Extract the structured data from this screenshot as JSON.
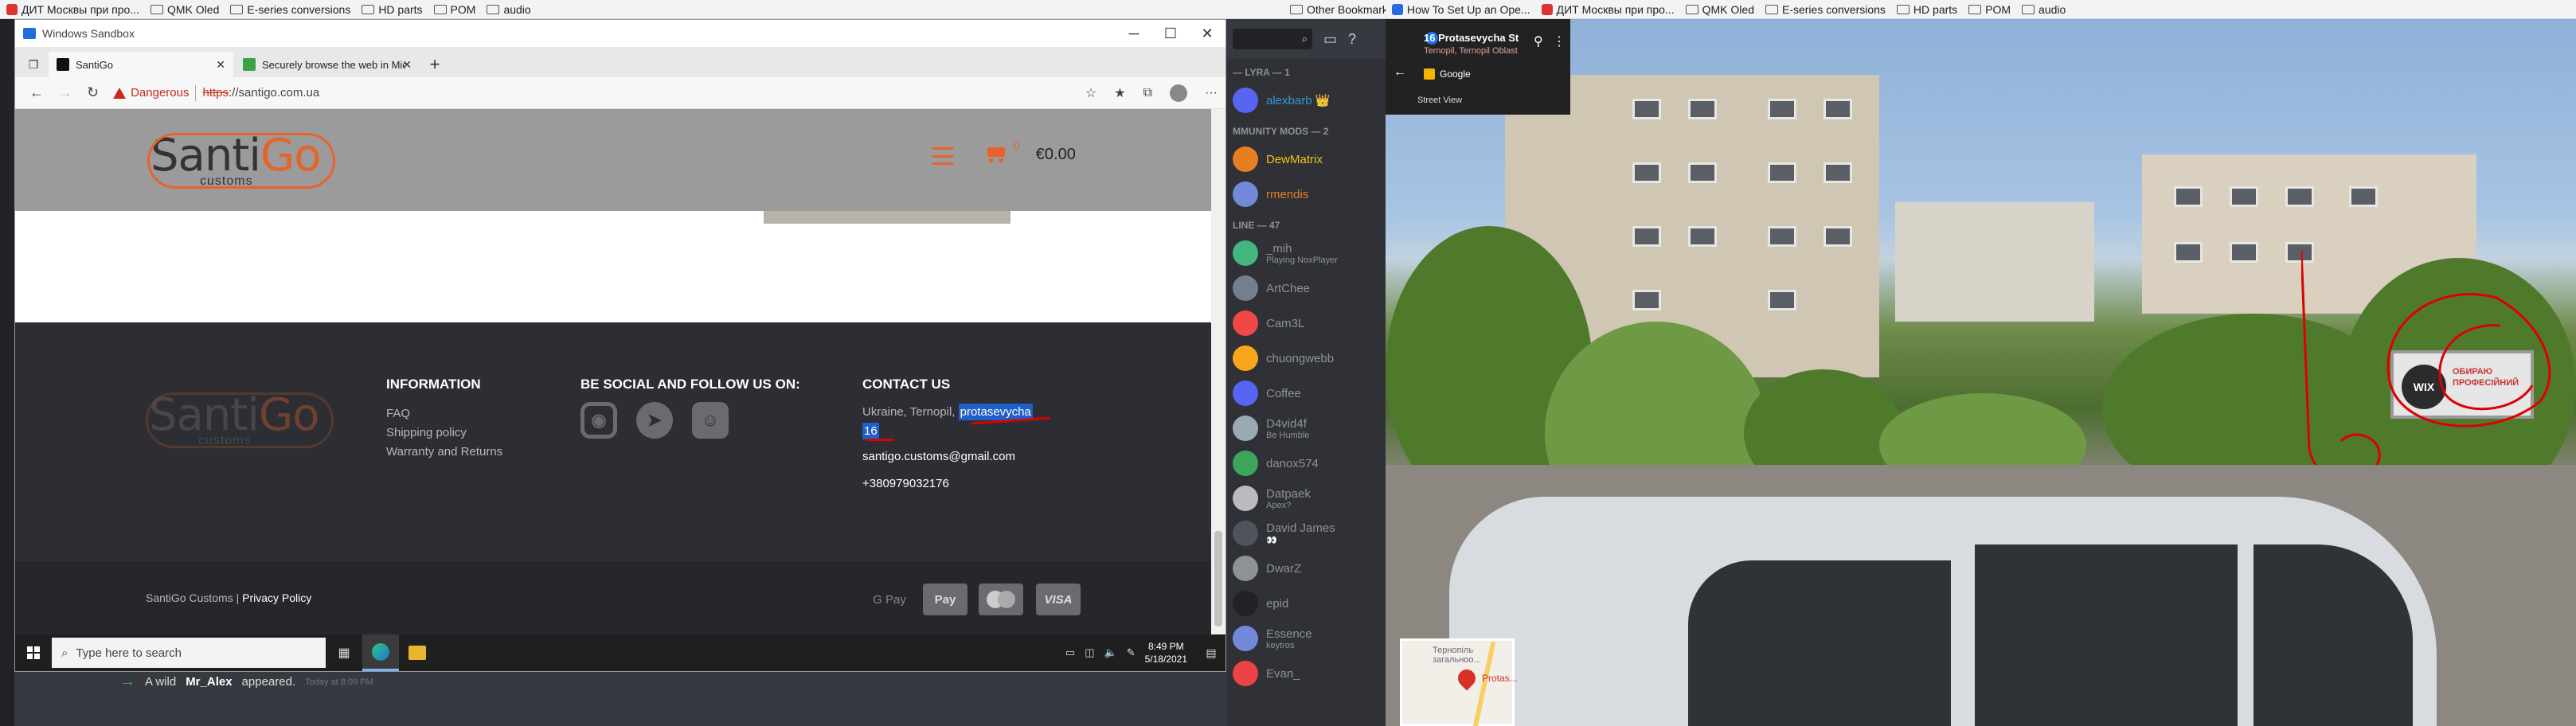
{
  "bookmarks_left": [
    {
      "icon": "red-flag-favicon",
      "label": "ДИТ Москвы при про..."
    },
    {
      "icon": "folder-icon",
      "label": "QMK Oled"
    },
    {
      "icon": "folder-icon",
      "label": "E-series conversions"
    },
    {
      "icon": "folder-icon",
      "label": "HD parts"
    },
    {
      "icon": "folder-icon",
      "label": "POM"
    },
    {
      "icon": "folder-icon",
      "label": "audio"
    }
  ],
  "bookmarks_left_other": "Other Bookmarks",
  "bookmarks_right": [
    {
      "icon": "github-favicon",
      "label": "How To Set Up an Ope..."
    },
    {
      "icon": "red-flag-favicon",
      "label": "ДИТ Москвы при про..."
    },
    {
      "icon": "folder-icon",
      "label": "QMK Oled"
    },
    {
      "icon": "folder-icon",
      "label": "E-series conversions"
    },
    {
      "icon": "folder-icon",
      "label": "HD parts"
    },
    {
      "icon": "folder-icon",
      "label": "POM"
    },
    {
      "icon": "folder-icon",
      "label": "audio"
    }
  ],
  "sandbox": {
    "title": "Windows Sandbox",
    "tabs": [
      {
        "label": "SantiGo",
        "active": true
      },
      {
        "label": "Securely browse the web in Micr",
        "active": false
      }
    ],
    "address": {
      "warning": "Dangerous",
      "scheme": "https",
      "rest": "://santigo.com.ua"
    }
  },
  "site": {
    "logo_main": "Santi",
    "logo_go": "Go",
    "logo_sub": "customs",
    "cart_count": "0",
    "cart_total": "€0.00",
    "footer": {
      "info_title": "INFORMATION",
      "info_links": [
        "FAQ",
        "Shipping policy",
        "Warranty and Returns"
      ],
      "social_title": "BE SOCIAL AND FOLLOW US ON:",
      "contact_title": "CONTACT US",
      "address_prefix": "Ukraine, Ternopil,",
      "address_street": "protasevycha",
      "address_number": "16",
      "email": "santigo.customs@gmail.com",
      "phone": "+380979032176"
    },
    "copyright": "SantiGo Customs",
    "copyright_sep": "|",
    "privacy": "Privacy Policy",
    "payments": [
      "G Pay",
      "Apple Pay",
      "Mastercard",
      "VISA"
    ],
    "payment_gpay": "G Pay",
    "payment_apay": " Pay",
    "payment_visa": "VISA"
  },
  "taskbar": {
    "search_placeholder": "Type here to search",
    "time": "8:49 PM",
    "date": "5/18/2021"
  },
  "discord": {
    "sections": [
      {
        "title": "— LYRA — 1",
        "members": [
          {
            "name": "alexbarb 👑",
            "role": "blue",
            "sub": ""
          }
        ]
      },
      {
        "title": "MMUNITY MODS — 2",
        "members": [
          {
            "name": "DewMatrix",
            "role": "gold",
            "sub": ""
          },
          {
            "name": "rmendis",
            "role": "orange",
            "sub": ""
          }
        ]
      },
      {
        "title": "LINE — 47",
        "members": [
          {
            "name": "_mih",
            "role": "",
            "sub": "Playing NoxPlayer"
          },
          {
            "name": "ArtChee",
            "role": "",
            "sub": ""
          },
          {
            "name": "Cam3L",
            "role": "",
            "sub": ""
          },
          {
            "name": "chuongwebb",
            "role": "",
            "sub": ""
          },
          {
            "name": "Coffee",
            "role": "",
            "sub": ""
          },
          {
            "name": "D4vid4f",
            "role": "",
            "sub": "Be Humble"
          },
          {
            "name": "danox574",
            "role": "",
            "sub": ""
          },
          {
            "name": "Datpaek",
            "role": "",
            "sub": "Apex?"
          },
          {
            "name": "David James",
            "role": "",
            "sub": "👀"
          },
          {
            "name": "DwarZ",
            "role": "",
            "sub": ""
          },
          {
            "name": "epid",
            "role": "",
            "sub": ""
          },
          {
            "name": "Essence",
            "role": "",
            "sub": "keytros"
          },
          {
            "name": "Evan_",
            "role": "",
            "sub": ""
          }
        ]
      }
    ],
    "system_message_prefix": "A wild",
    "system_message_name": "Mr_Alex",
    "system_message_suffix": "appeared.",
    "system_message_time": "Today at 8:09 PM"
  },
  "streetview": {
    "title": "16 Protasevycha St",
    "subtitle": "Ternopil, Ternopil Oblast",
    "provider": "Google",
    "label": "Street View",
    "billboard_brand": "WIX",
    "billboard_text": "ОБИРАЮ ПРОФЕСІЙНИЙ",
    "minimap_text": "Тернопіль загальноо...",
    "minimap_label": "Protas..."
  }
}
